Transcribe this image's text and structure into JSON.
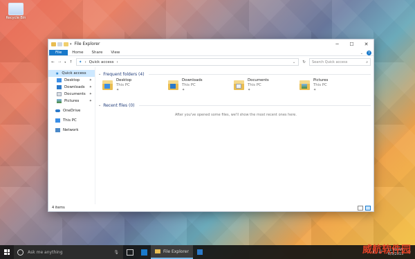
{
  "desktop": {
    "recycle_bin_label": "Recycle Bin"
  },
  "window": {
    "title": "File Explorer",
    "ribbon_tabs": [
      "File",
      "Home",
      "Share",
      "View"
    ],
    "address": {
      "path": "Quick access"
    },
    "search": {
      "placeholder": "Search Quick access"
    },
    "nav": {
      "quick_access": "Quick access",
      "items": [
        "Desktop",
        "Downloads",
        "Documents",
        "Pictures"
      ],
      "onedrive": "OneDrive",
      "this_pc": "This PC",
      "network": "Network"
    },
    "frequent": {
      "header": "Frequent folders (4)",
      "folders": [
        {
          "name": "Desktop",
          "location": "This PC"
        },
        {
          "name": "Downloads",
          "location": "This PC"
        },
        {
          "name": "Documents",
          "location": "This PC"
        },
        {
          "name": "Pictures",
          "location": "This PC"
        }
      ]
    },
    "recent": {
      "header": "Recent files (0)",
      "empty_message": "After you've opened some files, we'll show the most recent ones here."
    },
    "status": {
      "items_count": "4 items"
    }
  },
  "taskbar": {
    "search_placeholder": "Ask me anything",
    "active_app": "File Explorer",
    "clock_time": "11:43 AM",
    "clock_date": "6/5/2015"
  },
  "watermark_text": "威航软件园",
  "colors": {
    "accent": "#1979ca",
    "selection": "#cde8ff"
  }
}
